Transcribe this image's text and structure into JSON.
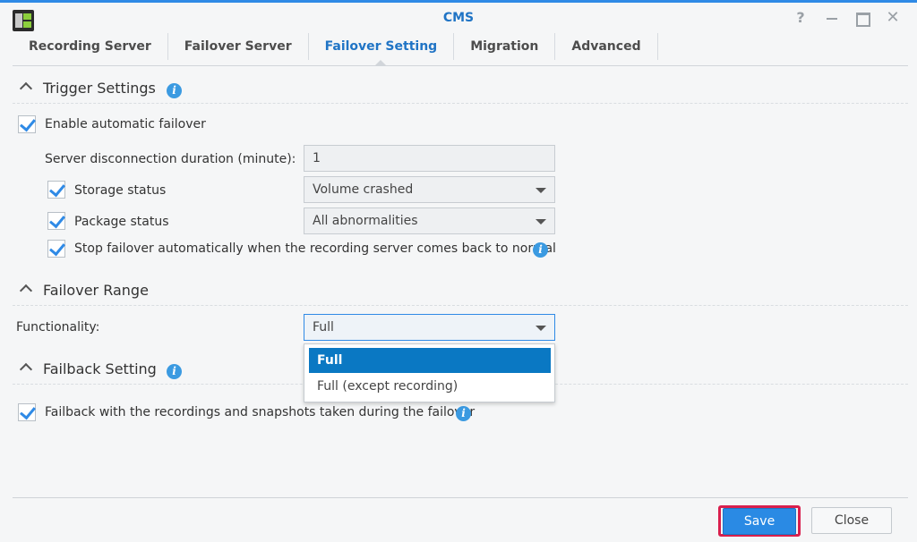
{
  "window": {
    "title": "CMS",
    "help_glyph": "?",
    "close_glyph": "✕"
  },
  "tabs": [
    {
      "label": "Recording Server"
    },
    {
      "label": "Failover Server"
    },
    {
      "label": "Failover Setting"
    },
    {
      "label": "Migration"
    },
    {
      "label": "Advanced"
    }
  ],
  "trigger": {
    "title": "Trigger Settings",
    "enable_auto_failover": {
      "label": "Enable automatic failover",
      "checked": true
    },
    "disconnect_duration": {
      "label": "Server disconnection duration (minute):",
      "value": "1"
    },
    "storage_status": {
      "label": "Storage status",
      "checked": true,
      "value": "Volume crashed"
    },
    "package_status": {
      "label": "Package status",
      "checked": true,
      "value": "All abnormalities"
    },
    "stop_failover": {
      "label": "Stop failover automatically when the recording server comes back to normal",
      "checked": true
    }
  },
  "range": {
    "title": "Failover Range",
    "functionality": {
      "label": "Functionality:",
      "value": "Full",
      "options": [
        "Full",
        "Full (except recording)"
      ]
    }
  },
  "failback": {
    "title": "Failback Setting",
    "with_recordings": {
      "label": "Failback with the recordings and snapshots taken during the failover",
      "checked": true
    }
  },
  "footer": {
    "save_label": "Save",
    "close_label": "Close"
  },
  "icons": {
    "info": "i"
  },
  "colors": {
    "accent": "#2f8ae6",
    "title": "#2074c5",
    "highlight": "#d91f4d"
  }
}
